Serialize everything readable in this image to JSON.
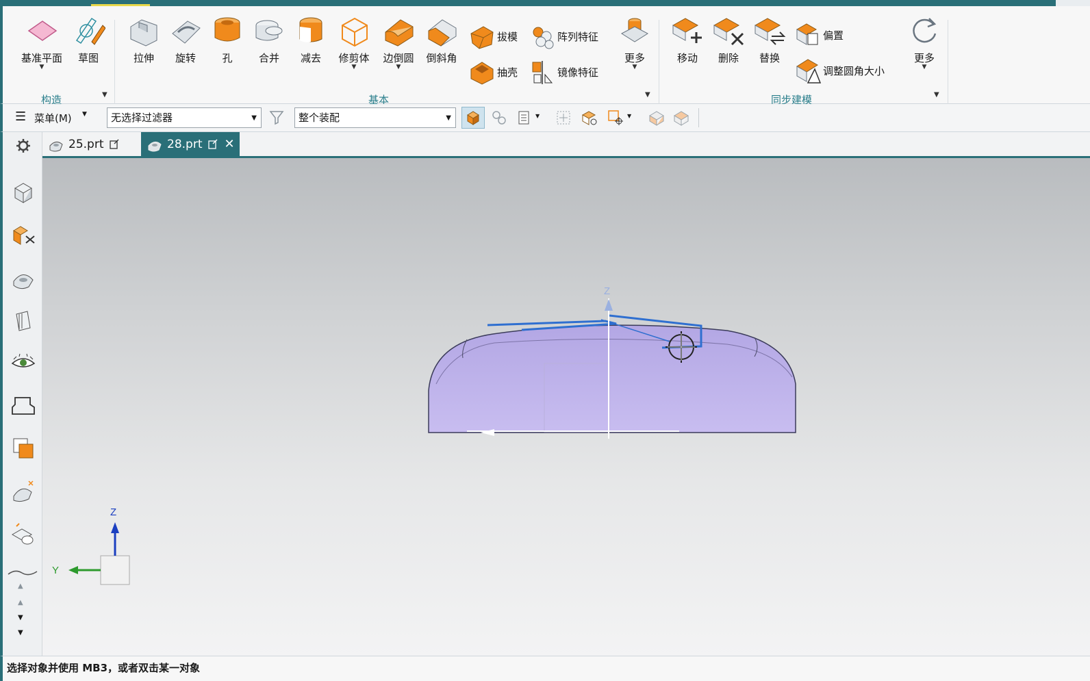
{
  "ribbon": {
    "construct": {
      "datum_plane": "基准平面",
      "sketch": "草图",
      "group_label": "构造"
    },
    "basic": {
      "extrude": "拉伸",
      "revolve": "旋转",
      "hole": "孔",
      "unite": "合并",
      "subtract": "减去",
      "trim_body": "修剪体",
      "edge_blend": "边倒圆",
      "chamfer": "倒斜角",
      "draft": "拔模",
      "pattern_feature": "阵列特征",
      "shell": "抽壳",
      "mirror_feature": "镜像特征",
      "more": "更多",
      "group_label": "基本"
    },
    "sync": {
      "move": "移动",
      "delete": "删除",
      "replace": "替换",
      "offset": "偏置",
      "resize_blend": "调整圆角大小",
      "more": "更多",
      "group_label": "同步建模"
    }
  },
  "toolbar": {
    "menu": "菜单(M)",
    "selection_filter": "无选择过滤器",
    "assembly_scope": "整个装配"
  },
  "tabs": [
    {
      "label": "25.prt",
      "active": false
    },
    {
      "label": "28.prt",
      "active": true
    }
  ],
  "viewport": {
    "triad": {
      "z": "Z",
      "y": "Y"
    },
    "part_axis": "Z"
  },
  "status": {
    "text": "选择对象并使用 MB3，或者双击某一对象"
  },
  "colors": {
    "accent_teal": "#2a6f78",
    "feature_orange": "#f08a1c",
    "body_lavender": "#c8bdf0",
    "sketch_blue": "#2f6fd0"
  }
}
